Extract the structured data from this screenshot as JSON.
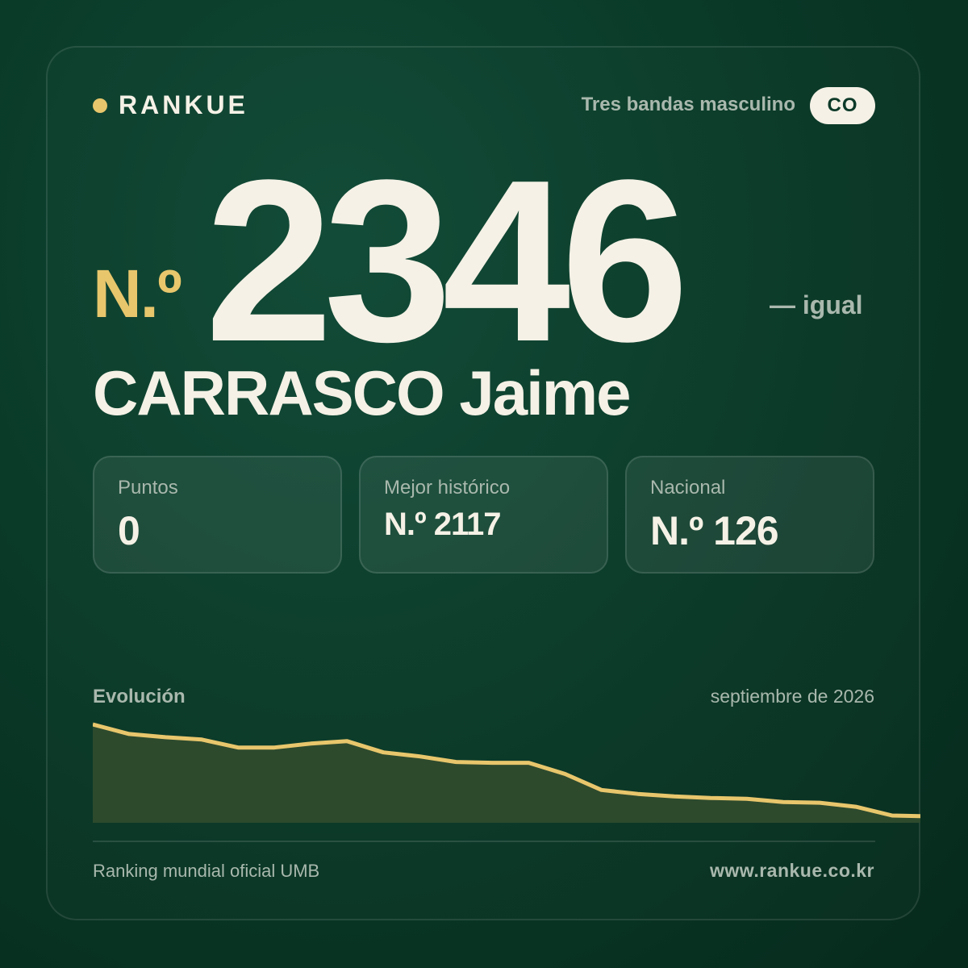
{
  "brand": {
    "name": "RANKUE",
    "accent_color": "#e8c66c"
  },
  "header": {
    "category": "Tres bandas masculino",
    "country_code": "CO"
  },
  "rank": {
    "prefix": "N.º",
    "number": "2346",
    "change": "— igual"
  },
  "player": {
    "name": "CARRASCO Jaime"
  },
  "stats": [
    {
      "label": "Puntos",
      "value": "0"
    },
    {
      "label": "Mejor histórico",
      "value": "N.º 2117"
    },
    {
      "label": "Nacional",
      "value": "N.º 126"
    }
  ],
  "evolution": {
    "title": "Evolución",
    "date": "septiembre de 2026"
  },
  "chart_data": {
    "type": "area",
    "values": [
      0,
      12,
      16,
      19,
      29,
      29,
      24,
      21,
      35,
      40,
      47,
      48,
      48,
      62,
      82,
      87,
      90,
      92,
      93,
      97,
      98,
      103,
      114,
      115
    ],
    "line_color": "#e8c66c",
    "fill_color": "#2d4a2d",
    "grid": false
  },
  "footer": {
    "left": "Ranking mundial oficial UMB",
    "right": "www.rankue.co.kr"
  },
  "colors": {
    "background": "#0a3a28",
    "text_primary": "#f5f1e6",
    "text_muted": "#a9b8ad"
  }
}
